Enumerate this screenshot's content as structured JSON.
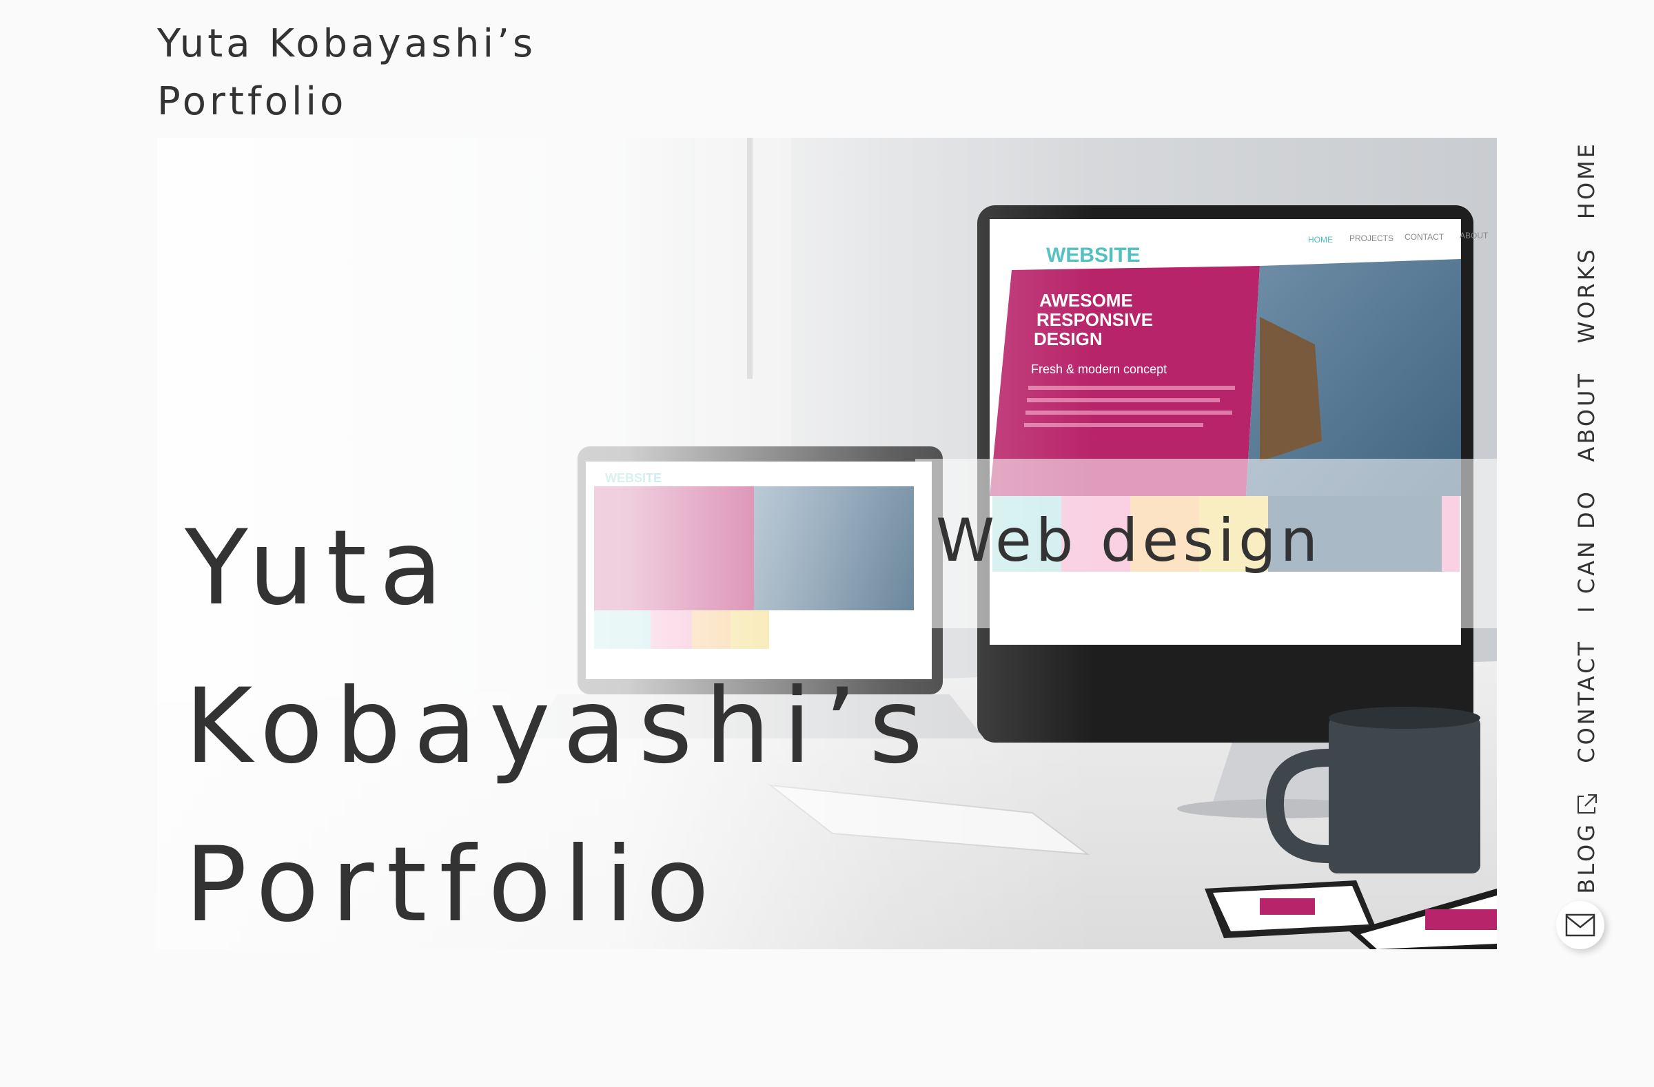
{
  "site_title": {
    "line1": "Yuta Kobayashi’s",
    "line2": "Portfolio"
  },
  "hero": {
    "title_line1": "Yuta",
    "title_line2": "Kobayashi’s",
    "title_line3": "Portfolio",
    "skill": "Web design",
    "mock_site": {
      "brand": "WEBSITE",
      "menu": [
        "HOME",
        "PROJECTS",
        "CONTACT",
        "ABOUT"
      ],
      "headline_line1": "AWESOME",
      "headline_line2": "RESPONSIVE",
      "headline_line3": "DESIGN",
      "subhead": "Fresh & modern concept"
    }
  },
  "nav": {
    "home": "HOME",
    "works": "WORKS",
    "about": "ABOUT",
    "i_can_do": "I CAN DO",
    "contact": "CONTACT",
    "blog": "BLOG"
  },
  "icons": {
    "blog": "external-link-icon",
    "mail": "mail-icon"
  },
  "colors": {
    "text": "#333333",
    "background": "#fafafa",
    "mock_pink": "#b8246a",
    "mock_teal": "#4fbfc0"
  }
}
